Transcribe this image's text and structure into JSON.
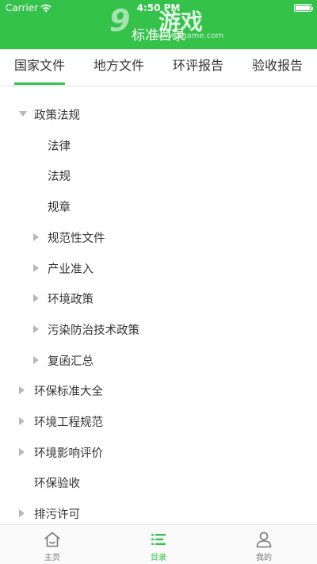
{
  "status_bar": {
    "carrier": "Carrier",
    "time": "4:50 PM"
  },
  "nav": {
    "title": "标准目录"
  },
  "watermark": {
    "number": "9",
    "text": "游戏",
    "url": "www.9game.com"
  },
  "tabs": [
    {
      "label": "国家文件",
      "active": true
    },
    {
      "label": "地方文件",
      "active": false
    },
    {
      "label": "环评报告",
      "active": false
    },
    {
      "label": "验收报告",
      "active": false
    }
  ],
  "tree": [
    {
      "label": "政策法规",
      "level": 0,
      "arrow": "down"
    },
    {
      "label": "法律",
      "level": 1,
      "arrow": "none"
    },
    {
      "label": "法规",
      "level": 1,
      "arrow": "none"
    },
    {
      "label": "规章",
      "level": 1,
      "arrow": "none"
    },
    {
      "label": "规范性文件",
      "level": 1,
      "arrow": "right"
    },
    {
      "label": "产业准入",
      "level": 1,
      "arrow": "right"
    },
    {
      "label": "环境政策",
      "level": 1,
      "arrow": "right"
    },
    {
      "label": "污染防治技术政策",
      "level": 1,
      "arrow": "right"
    },
    {
      "label": "复函汇总",
      "level": 1,
      "arrow": "right"
    },
    {
      "label": "环保标准大全",
      "level": 0,
      "arrow": "right"
    },
    {
      "label": "环境工程规范",
      "level": 0,
      "arrow": "right"
    },
    {
      "label": "环境影响评价",
      "level": 0,
      "arrow": "right"
    },
    {
      "label": "环保验收",
      "level": 0,
      "arrow": "none"
    },
    {
      "label": "排污许可",
      "level": 0,
      "arrow": "right"
    }
  ],
  "tabbar": [
    {
      "label": "主页",
      "icon": "home-icon",
      "active": false
    },
    {
      "label": "目录",
      "icon": "list-icon",
      "active": true
    },
    {
      "label": "我的",
      "icon": "user-icon",
      "active": false
    }
  ],
  "colors": {
    "brand": "#34c24a",
    "arrow": "#b7b7b7",
    "text": "#333333"
  }
}
